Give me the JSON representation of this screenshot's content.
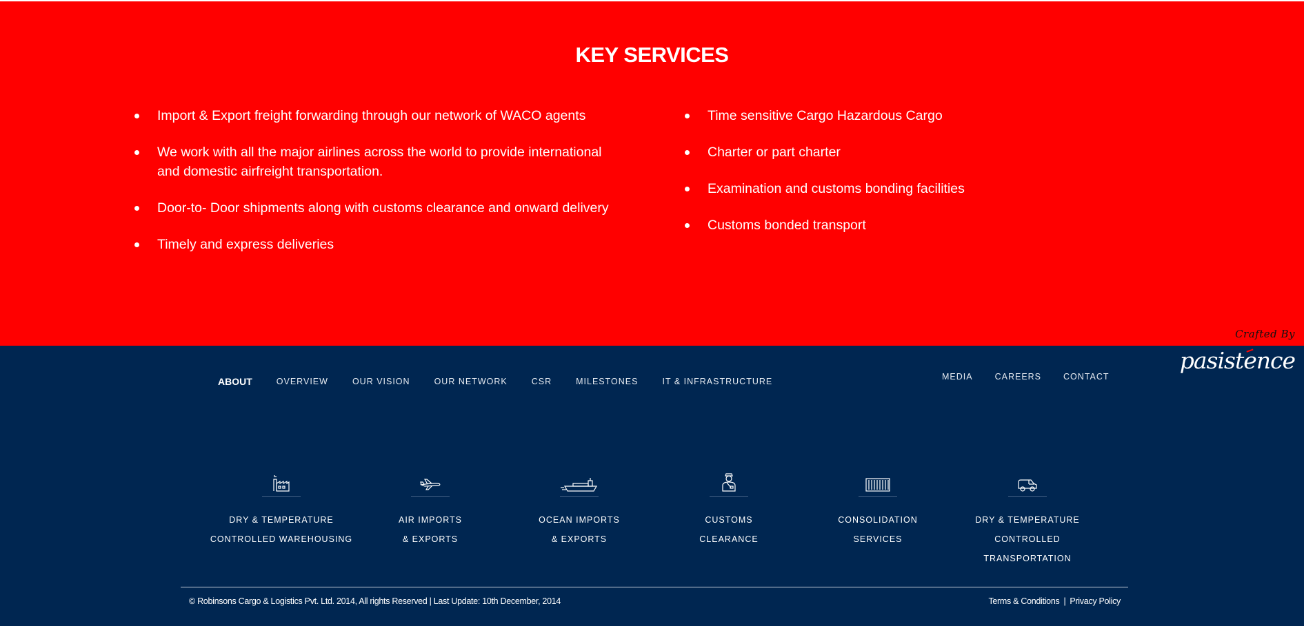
{
  "key_services": {
    "title": "KEY SERVICES",
    "left_items": [
      "Import & Export freight forwarding through our network of WACO agents",
      "We work with all the major airlines across the world to provide international and domestic airfreight transportation.",
      "Door-to- Door shipments along with customs clearance and onward delivery",
      "Timely and express deliveries"
    ],
    "right_items": [
      "Time sensitive Cargo Hazardous Cargo",
      "Charter or part charter",
      "Examination and customs bonding facilities",
      "Customs bonded transport"
    ]
  },
  "nav": {
    "left": [
      "ABOUT",
      "OVERVIEW",
      "OUR VISION",
      "OUR NETWORK",
      "CSR",
      "MILESTONES",
      "IT & INFRASTRUCTURE"
    ],
    "right": [
      "MEDIA",
      "CAREERS",
      "CONTACT"
    ]
  },
  "crafted": {
    "label": "Crafted By",
    "brand": "pasistence"
  },
  "services": [
    {
      "icon": "warehouse-icon",
      "line1": "DRY & TEMPERATURE",
      "line2": "CONTROLLED WAREHOUSING"
    },
    {
      "icon": "airplane-icon",
      "line1": "AIR IMPORTS",
      "line2": "& EXPORTS"
    },
    {
      "icon": "ship-icon",
      "line1": "OCEAN IMPORTS",
      "line2": "& EXPORTS"
    },
    {
      "icon": "customs-officer-icon",
      "line1": "CUSTOMS",
      "line2": "CLEARANCE"
    },
    {
      "icon": "container-icon",
      "line1": "CONSOLIDATION",
      "line2": "SERVICES"
    },
    {
      "icon": "truck-icon",
      "line1": "DRY & TEMPERATURE",
      "line2": "CONTROLLED TRANSPORTATION"
    }
  ],
  "footer": {
    "copyright": "© Robinsons Cargo & Logistics Pvt. Ltd. 2014, All rights Reserved  |  Last Update: 10th December, 2014",
    "terms": "Terms & Conditions",
    "privacy": "Privacy Policy",
    "separator": "|"
  },
  "colors": {
    "red_bg": "#ff0000",
    "navy_bg": "#002651"
  }
}
